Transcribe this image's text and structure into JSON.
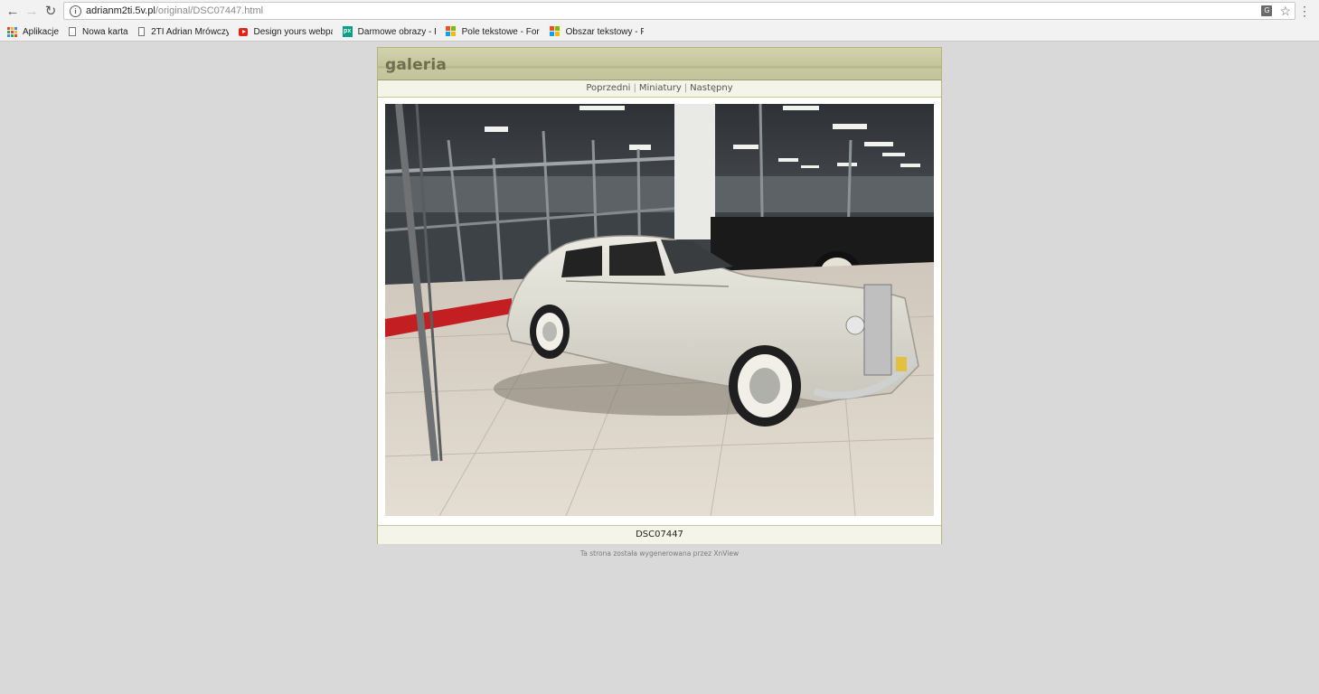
{
  "browser": {
    "url_host": "adrianm2ti.5v.pl",
    "url_path": "/original/DSC07447.html",
    "bookmarks": [
      {
        "label": "Aplikacje",
        "icon": "apps-grid-icon"
      },
      {
        "label": "Nowa karta",
        "icon": "page-icon"
      },
      {
        "label": "2TI Adrian Mrówczyń",
        "icon": "page-icon"
      },
      {
        "label": "Design yours webpag",
        "icon": "youtube-icon"
      },
      {
        "label": "Darmowe obrazy - Pi",
        "icon": "pixabay-icon"
      },
      {
        "label": "Pole tekstowe - Form",
        "icon": "multicolor-square-icon"
      },
      {
        "label": "Obszar tekstowy - Fo",
        "icon": "multicolor-square-icon"
      }
    ]
  },
  "gallery": {
    "title": "galeria",
    "nav": {
      "prev": "Poprzedni",
      "separator": "|",
      "thumbs": "Miniatury",
      "next": "Następny"
    },
    "photo_alt": "DSC07447",
    "caption": "DSC07447",
    "footer": "Ta strona została wygenerowana przez XnView"
  },
  "colors": {
    "page_bg": "#d9d9d9",
    "header_bg": "#c6c69c",
    "border": "#b6b67a",
    "title": "#6f6f4f"
  }
}
